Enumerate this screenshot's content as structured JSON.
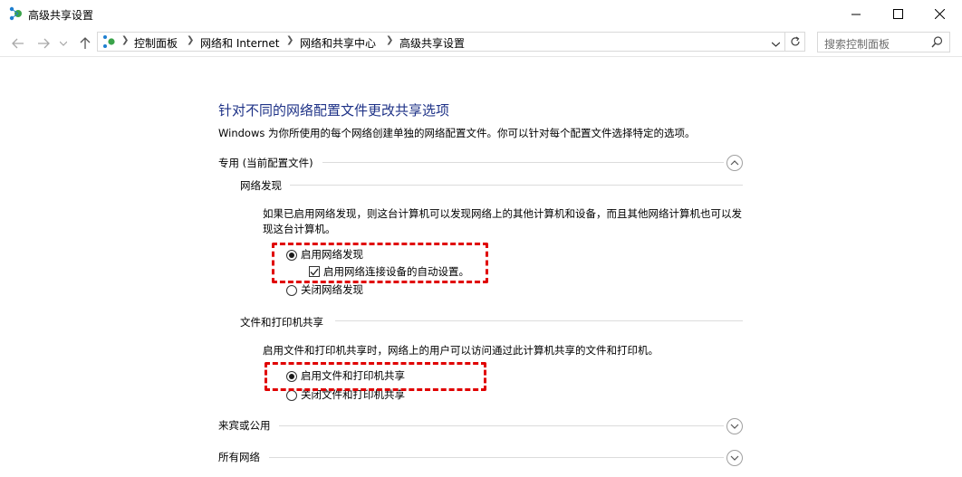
{
  "window": {
    "title": "高级共享设置"
  },
  "breadcrumbs": [
    "控制面板",
    "网络和 Internet",
    "网络和共享中心",
    "高级共享设置"
  ],
  "search": {
    "placeholder": "搜索控制面板"
  },
  "main": {
    "heading": "针对不同的网络配置文件更改共享选项",
    "description": "Windows 为你所使用的每个网络创建单独的网络配置文件。你可以针对每个配置文件选择特定的选项。",
    "profiles": [
      {
        "label": "专用 (当前配置文件)",
        "expanded": true,
        "network_discovery": {
          "title": "网络发现",
          "text": "如果已启用网络发现，则这台计算机可以发现网络上的其他计算机和设备，而且其他网络计算机也可以发现这台计算机。",
          "options": [
            "启用网络发现",
            "关闭网络发现"
          ],
          "selected": 0,
          "auto_setup_label": "启用网络连接设备的自动设置。",
          "auto_setup_checked": true
        },
        "file_sharing": {
          "title": "文件和打印机共享",
          "text": "启用文件和打印机共享时，网络上的用户可以访问通过此计算机共享的文件和打印机。",
          "options": [
            "启用文件和打印机共享",
            "关闭文件和打印机共享"
          ],
          "selected": 0
        }
      },
      {
        "label": "来宾或公用",
        "expanded": false
      },
      {
        "label": "所有网络",
        "expanded": false
      }
    ]
  },
  "colors": {
    "heading": "#1e3287",
    "highlight": "#e00000"
  },
  "icons": [
    "network-app-icon",
    "minimize-icon",
    "maximize-icon",
    "close-icon",
    "back-arrow-icon",
    "forward-arrow-icon",
    "dropdown-arrow-icon",
    "up-arrow-icon",
    "network-location-icon",
    "chevron-right-icon",
    "chevron-down-icon",
    "refresh-icon",
    "search-icon",
    "chevron-up-icon"
  ]
}
